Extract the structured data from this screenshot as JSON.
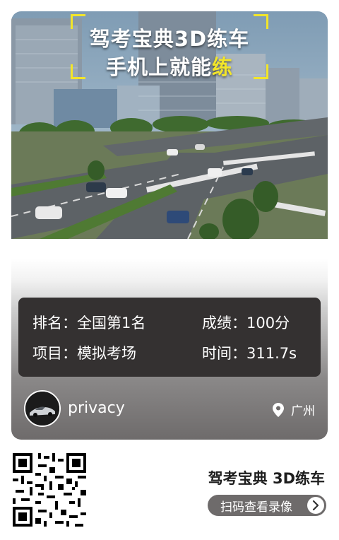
{
  "hero": {
    "headline_line1": "驾考宝典3D练车",
    "headline_line2_main": "手机上就能",
    "headline_line2_accent": "练",
    "accent_color": "#f2e52a"
  },
  "stats": {
    "rank": "排名：全国第1名",
    "score": "成绩：100分",
    "item": "项目：模拟考场",
    "time": "时间：311.7s"
  },
  "user": {
    "name": "privacy",
    "location": "广州",
    "avatar_icon": "car-avatar-icon",
    "location_icon": "location-pin-icon"
  },
  "footer": {
    "brand": "驾考宝典 3D练车",
    "replay_label": "扫码查看录像",
    "qr_icon": "qr-code-icon",
    "arrow_icon": "chevron-right-icon"
  }
}
